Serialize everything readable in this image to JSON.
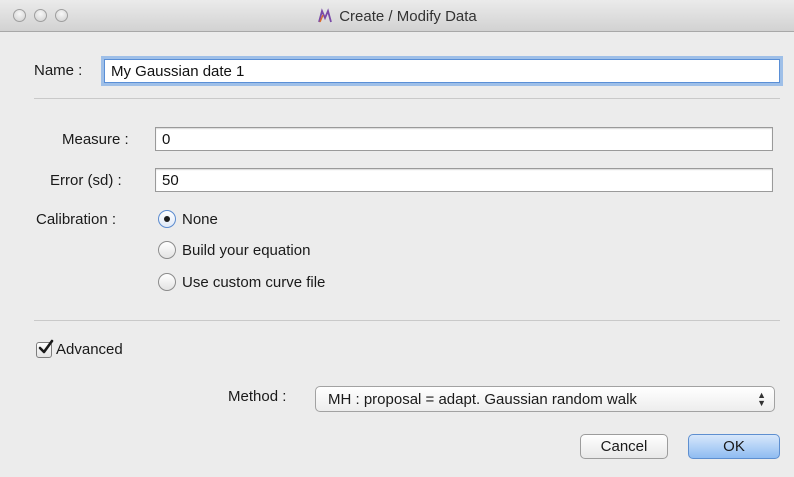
{
  "window": {
    "title": "Create / Modify Data"
  },
  "name_field": {
    "label": "Name :",
    "value": "My Gaussian date 1"
  },
  "measure_field": {
    "label": "Measure :",
    "value": "0"
  },
  "error_field": {
    "label": "Error (sd) :",
    "value": "50"
  },
  "calibration": {
    "label": "Calibration :",
    "options": [
      {
        "label": "None",
        "selected": true
      },
      {
        "label": "Build your equation",
        "selected": false
      },
      {
        "label": "Use custom curve file",
        "selected": false
      }
    ]
  },
  "advanced": {
    "label": "Advanced",
    "checked": true
  },
  "method": {
    "label": "Method :",
    "selected": "MH : proposal = adapt. Gaussian random walk"
  },
  "buttons": {
    "cancel": "Cancel",
    "ok": "OK"
  },
  "colors": {
    "focus_ring": "#5e9ae6",
    "default_button": "#8fbcf1"
  }
}
